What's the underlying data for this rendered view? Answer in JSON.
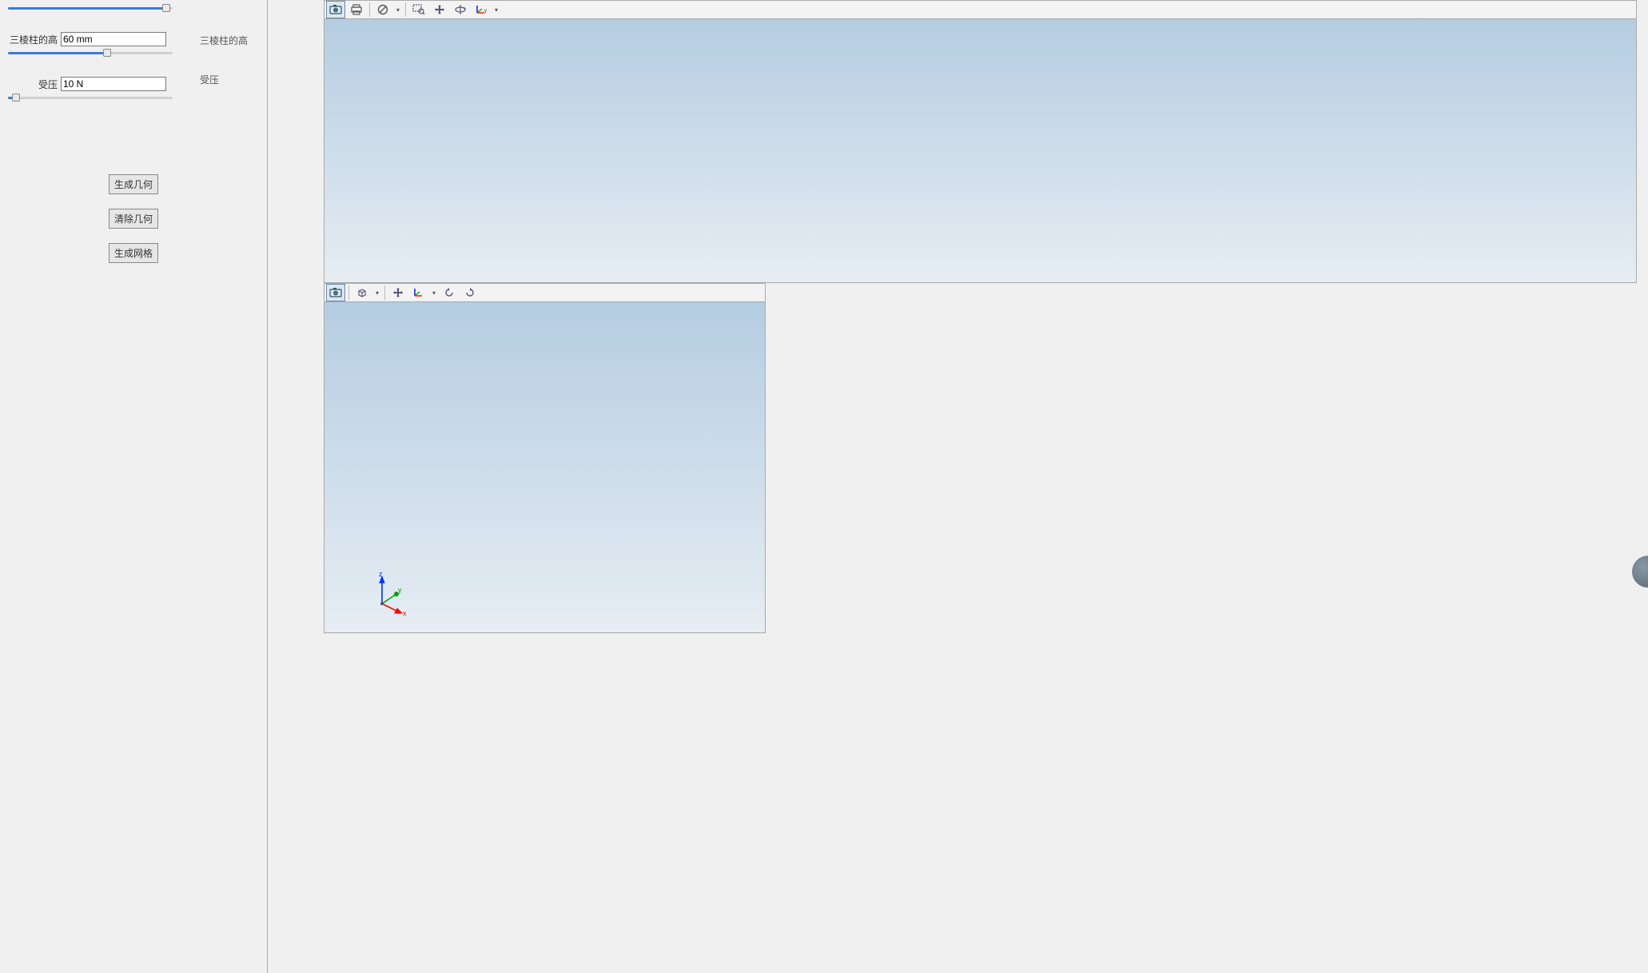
{
  "sidebar": {
    "slider0": {
      "fillPct": 96,
      "thumbPct": 96
    },
    "field1": {
      "label": "三棱柱的高",
      "value": "60 mm",
      "fillPct": 60,
      "thumbPct": 60
    },
    "field2": {
      "label": "受压",
      "value": "10 N",
      "fillPct": 5,
      "thumbPct": 5
    },
    "rightLabel1": "三棱柱的高",
    "rightLabel2": "受压",
    "buttons": {
      "gen_geom": "生成几何",
      "clear_geom": "清除几何",
      "gen_mesh": "生成网格"
    }
  },
  "toolbarTop": {
    "camera": "camera-icon",
    "print": "print-icon",
    "ruler": "circle-slash-icon",
    "zoom_box": "zoom-box-icon",
    "pan": "pan-icon",
    "rotate": "rotate-3d-icon",
    "axes": "axes-icon"
  },
  "toolbarBottom": {
    "camera": "camera-icon",
    "cube": "cube-icon",
    "pan": "pan-icon",
    "axes": "axes-icon",
    "rot_ccw": "rotate-ccw-icon",
    "rot_cw": "rotate-cw-icon"
  },
  "triad": {
    "x": "x",
    "y": "y",
    "z": "z"
  }
}
